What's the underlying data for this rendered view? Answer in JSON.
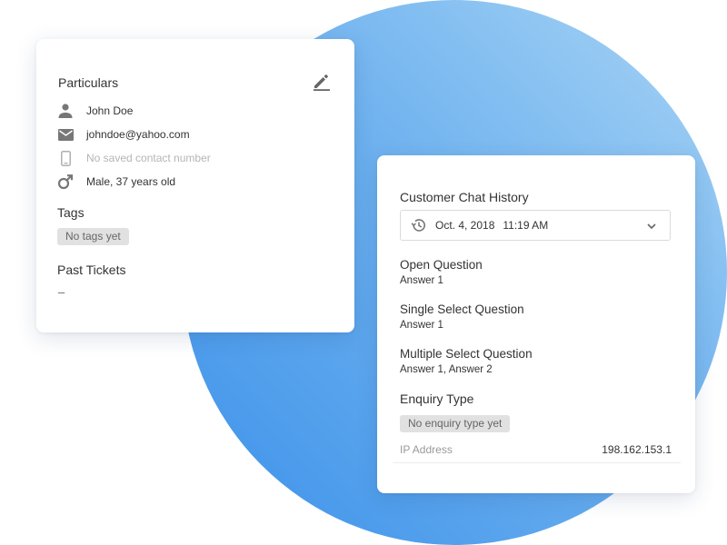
{
  "particulars": {
    "title": "Particulars",
    "name": "John Doe",
    "email": "johndoe@yahoo.com",
    "phone": "No saved contact number",
    "gender_age": "Male, 37 years old",
    "tags_title": "Tags",
    "tags_badge": "No tags yet",
    "past_tickets_title": "Past Tickets",
    "past_tickets_value": "–"
  },
  "chat_history": {
    "title": "Customer Chat History",
    "selected_date": "Oct. 4, 2018",
    "selected_time": "11:19 AM",
    "questions": [
      {
        "title": "Open Question",
        "answer": "Answer 1"
      },
      {
        "title": "Single Select Question",
        "answer": "Answer 1"
      },
      {
        "title": "Multiple Select Question",
        "answer": "Answer 1, Answer 2"
      }
    ],
    "enquiry_title": "Enquiry Type",
    "enquiry_badge": "No enquiry type yet",
    "ip_label": "IP Address",
    "ip_value": "198.162.153.1"
  },
  "colors": {
    "circle_light": "#a9d5f5",
    "circle_dark": "#3c91ea",
    "icon_gray": "#777777",
    "badge_bg": "#e1e1e1"
  },
  "icons": [
    "person-icon",
    "mail-icon",
    "phone-icon",
    "male-icon",
    "edit-icon",
    "history-icon",
    "chevron-down-icon"
  ]
}
